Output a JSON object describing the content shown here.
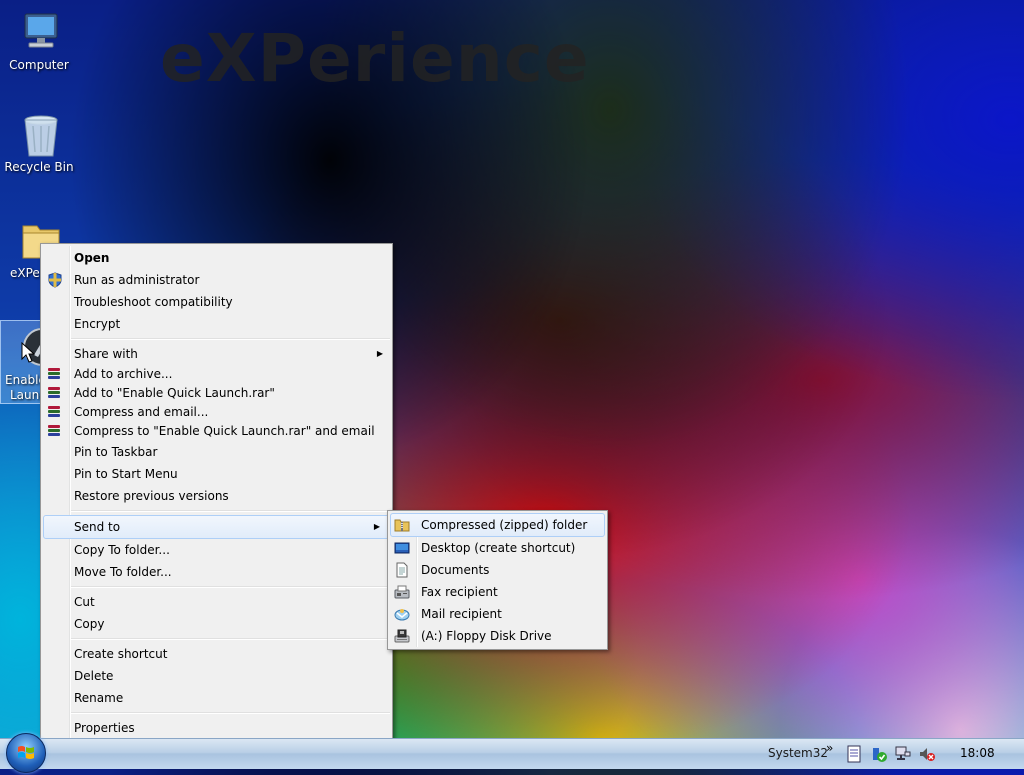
{
  "wallpaper": {
    "logo_text": "eXPerience"
  },
  "desktop_icons": [
    {
      "label": "Computer"
    },
    {
      "label": "Recycle Bin"
    },
    {
      "label": "eXPer"
    },
    {
      "label": "Enable Quick Launch",
      "line1": "Enable",
      "line2": "Launc"
    }
  ],
  "context_menu": {
    "items": [
      {
        "label": "Open",
        "bold": true
      },
      {
        "label": "Run as administrator",
        "icon": "shield-icon"
      },
      {
        "label": "Troubleshoot compatibility"
      },
      {
        "label": "Encrypt"
      },
      {
        "label": "Share with",
        "submenu": true
      },
      {
        "label": "Add to archive...",
        "icon": "winrar-icon"
      },
      {
        "label": "Add to \"Enable Quick Launch.rar\"",
        "icon": "winrar-icon"
      },
      {
        "label": "Compress and email...",
        "icon": "winrar-icon"
      },
      {
        "label": "Compress to \"Enable Quick Launch.rar\" and email",
        "icon": "winrar-icon"
      },
      {
        "label": "Pin to Taskbar"
      },
      {
        "label": "Pin to Start Menu"
      },
      {
        "label": "Restore previous versions"
      },
      {
        "label": "Send to",
        "submenu": true,
        "highlighted": true
      },
      {
        "label": "Copy To folder..."
      },
      {
        "label": "Move To folder..."
      },
      {
        "label": "Cut"
      },
      {
        "label": "Copy"
      },
      {
        "label": "Create shortcut"
      },
      {
        "label": "Delete"
      },
      {
        "label": "Rename"
      },
      {
        "label": "Properties"
      }
    ]
  },
  "send_to_menu": {
    "items": [
      {
        "label": "Compressed (zipped) folder",
        "icon": "zip-folder-icon",
        "highlighted": true
      },
      {
        "label": "Desktop (create shortcut)",
        "icon": "desktop-icon"
      },
      {
        "label": "Documents",
        "icon": "documents-icon"
      },
      {
        "label": "Fax recipient",
        "icon": "fax-icon"
      },
      {
        "label": "Mail recipient",
        "icon": "mail-icon"
      },
      {
        "label": "(A:) Floppy Disk Drive",
        "icon": "floppy-drive-icon"
      }
    ]
  },
  "taskbar": {
    "toolbar_label": "System32",
    "overflow_glyph": "»",
    "clock": "18:08"
  }
}
